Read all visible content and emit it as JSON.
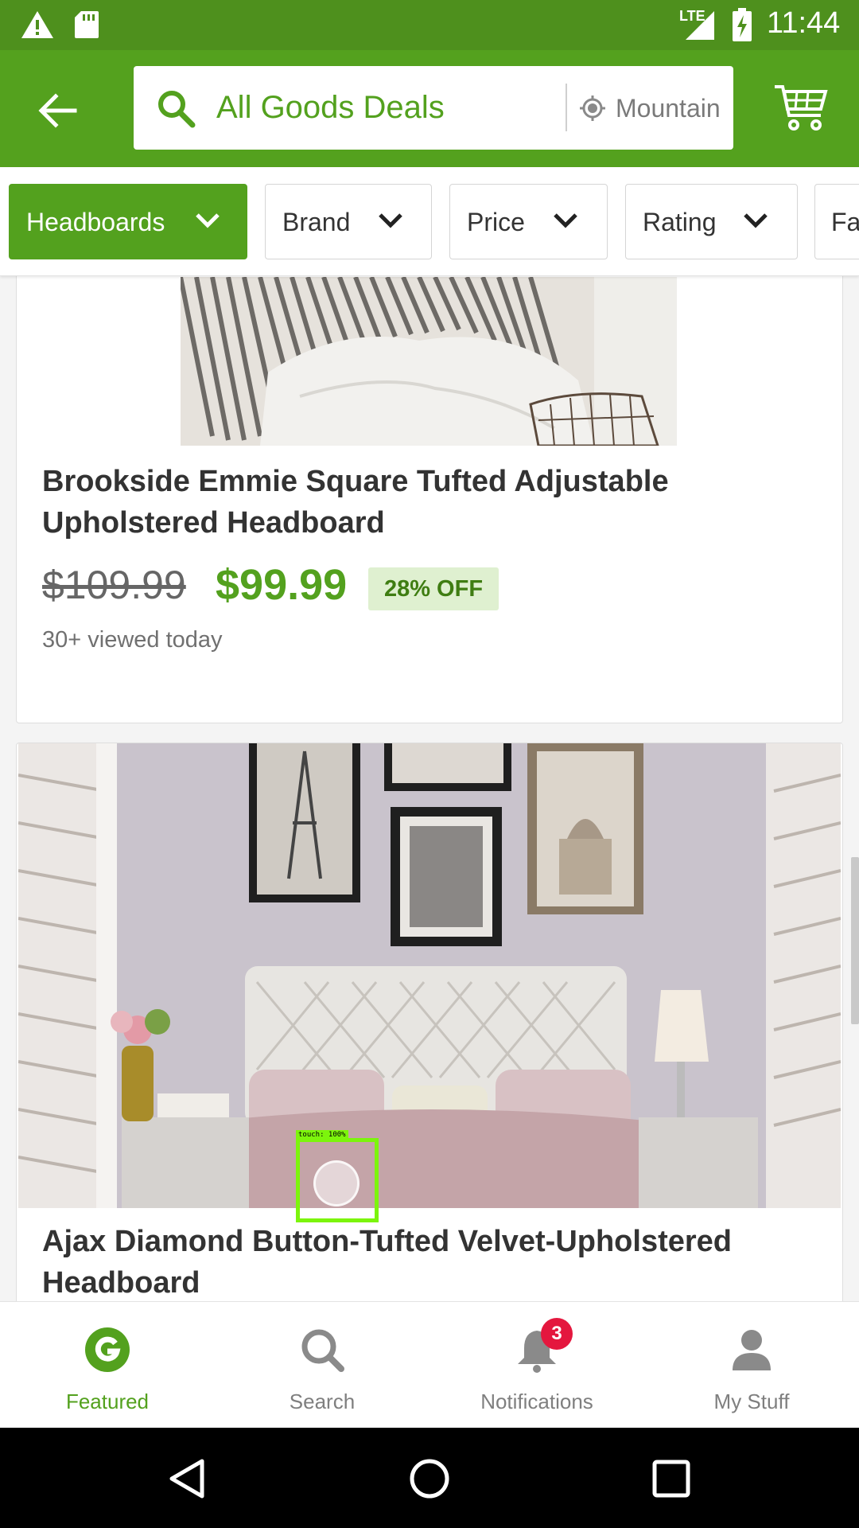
{
  "status_bar": {
    "network": "LTE",
    "time": "11:44"
  },
  "header": {
    "search_text": "All Goods Deals",
    "location_text": "Mountain View"
  },
  "filters": [
    {
      "label": "Headboards"
    },
    {
      "label": "Brand"
    },
    {
      "label": "Price"
    },
    {
      "label": "Rating"
    },
    {
      "label": "Fa"
    }
  ],
  "products": [
    {
      "title": "Brookside Emmie Square Tufted Adjustable Upholstered Headboard",
      "old_price": "$109.99",
      "new_price": "$99.99",
      "discount": "28% OFF",
      "viewed": "30+ viewed today"
    },
    {
      "title": "Ajax Diamond Button-Tufted Velvet-Upholstered Headboard"
    }
  ],
  "touch_overlay": {
    "label": "touch: 100%"
  },
  "bottom_nav": {
    "items": [
      {
        "label": "Featured"
      },
      {
        "label": "Search"
      },
      {
        "label": "Notifications"
      },
      {
        "label": "My Stuff"
      }
    ],
    "notifications_badge": "3"
  },
  "colors": {
    "brand_green": "#53a11e",
    "status_green": "#4e901d",
    "badge_red": "#e4173e"
  }
}
